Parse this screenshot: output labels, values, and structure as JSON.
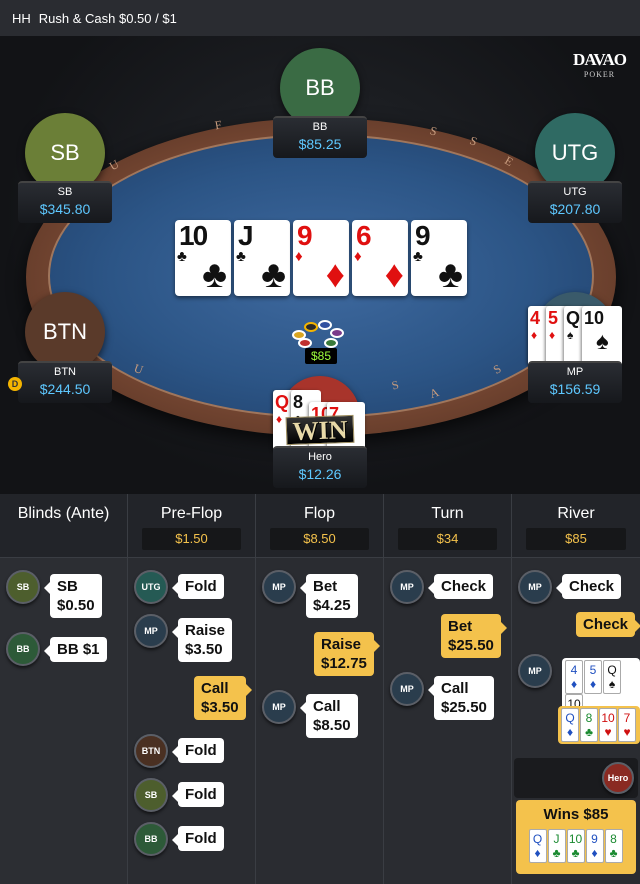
{
  "title": {
    "prefix": "HH",
    "game": "Rush & Cash $0.50 / $1"
  },
  "logo": {
    "line1": "DAVAO",
    "line2": "POKER"
  },
  "rail_letters": [
    "F",
    "U",
    "S",
    "E",
    "S",
    "U",
    "S",
    "A",
    "S"
  ],
  "players": {
    "bb": {
      "seat": "BB",
      "name": "BB",
      "stack": "$85.25",
      "color": "#3a6b44"
    },
    "sb": {
      "seat": "SB",
      "name": "SB",
      "stack": "$345.80",
      "color": "#6b7f37"
    },
    "utg": {
      "seat": "UTG",
      "name": "UTG",
      "stack": "$207.80",
      "color": "#2f6a63"
    },
    "btn": {
      "seat": "BTN",
      "name": "BTN",
      "stack": "$244.50",
      "color": "#5a3a2a"
    },
    "mp": {
      "seat": "",
      "name": "MP",
      "stack": "$156.59",
      "color": "#3a5a6a"
    },
    "hero": {
      "seat": "",
      "name": "Hero",
      "stack": "$12.26",
      "color": "#a8342b"
    }
  },
  "dealer_button": "D",
  "board": [
    {
      "rank": "10",
      "suit": "♣",
      "color": "blk"
    },
    {
      "rank": "J",
      "suit": "♣",
      "color": "blk"
    },
    {
      "rank": "9",
      "suit": "♦",
      "color": "red"
    },
    {
      "rank": "6",
      "suit": "♦",
      "color": "red"
    },
    {
      "rank": "9",
      "suit": "♣",
      "color": "blk"
    }
  ],
  "mp_hand": [
    {
      "rank": "4",
      "suit": "♦",
      "color": "red"
    },
    {
      "rank": "5",
      "suit": "♦",
      "color": "red"
    },
    {
      "rank": "Q",
      "suit": "♠",
      "color": "blk"
    },
    {
      "rank": "10",
      "suit": "♠",
      "color": "blk"
    }
  ],
  "hero_hand": [
    {
      "rank": "Q",
      "suit": "♦",
      "color": "red"
    },
    {
      "rank": "8",
      "suit": "♣",
      "color": "blk"
    },
    {
      "rank": "10",
      "suit": "♥",
      "color": "red"
    },
    {
      "rank": "7",
      "suit": "♥",
      "color": "red"
    }
  ],
  "pot": "$85",
  "win_label": "WIN",
  "history": {
    "blinds": {
      "title": "Blinds (Ante)"
    },
    "preflop": {
      "title": "Pre-Flop",
      "pot": "$1.50"
    },
    "flop": {
      "title": "Flop",
      "pot": "$8.50"
    },
    "turn": {
      "title": "Turn",
      "pot": "$34"
    },
    "river": {
      "title": "River",
      "pot": "$85"
    }
  },
  "actions": {
    "b1": {
      "who": "SB",
      "l1": "SB",
      "l2": "$0.50"
    },
    "b2": {
      "who": "BB",
      "l1": "BB $1"
    },
    "p1": {
      "who": "UTG",
      "l1": "Fold"
    },
    "p2": {
      "who": "MP",
      "l1": "Raise",
      "l2": "$3.50"
    },
    "p3": {
      "l1": "Call",
      "l2": "$3.50"
    },
    "p4": {
      "who": "BTN",
      "l1": "Fold"
    },
    "p5": {
      "who": "SB",
      "l1": "Fold"
    },
    "p6": {
      "who": "BB",
      "l1": "Fold"
    },
    "f1": {
      "who": "MP",
      "l1": "Bet",
      "l2": "$4.25"
    },
    "f2": {
      "l1": "Raise",
      "l2": "$12.75"
    },
    "f3": {
      "who": "MP",
      "l1": "Call",
      "l2": "$8.50"
    },
    "t1": {
      "who": "MP",
      "l1": "Check"
    },
    "t2": {
      "l1": "Bet",
      "l2": "$25.50"
    },
    "t3": {
      "who": "MP",
      "l1": "Call",
      "l2": "$25.50"
    },
    "r1": {
      "who": "MP",
      "l1": "Check"
    },
    "r2": {
      "l1": "Check"
    },
    "r3": {
      "who": "MP"
    },
    "r4": {
      "who": "Hero",
      "l1": "Wins $85"
    }
  },
  "showdown_mp": [
    {
      "rank": "4",
      "suit": "♦",
      "color": "blue"
    },
    {
      "rank": "5",
      "suit": "♦",
      "color": "blue"
    },
    {
      "rank": "Q",
      "suit": "♠",
      "color": "blk"
    },
    {
      "rank": "10",
      "suit": "♠",
      "color": "blk"
    }
  ],
  "showdown_hero": [
    {
      "rank": "Q",
      "suit": "♦",
      "color": "blue"
    },
    {
      "rank": "8",
      "suit": "♣",
      "color": "green"
    },
    {
      "rank": "10",
      "suit": "♥",
      "color": "red"
    },
    {
      "rank": "7",
      "suit": "♥",
      "color": "red"
    }
  ],
  "win_board": [
    {
      "rank": "Q",
      "suit": "♦",
      "color": "blue"
    },
    {
      "rank": "J",
      "suit": "♣",
      "color": "green"
    },
    {
      "rank": "10",
      "suit": "♣",
      "color": "green"
    },
    {
      "rank": "9",
      "suit": "♦",
      "color": "blue"
    },
    {
      "rank": "8",
      "suit": "♣",
      "color": "green"
    }
  ]
}
